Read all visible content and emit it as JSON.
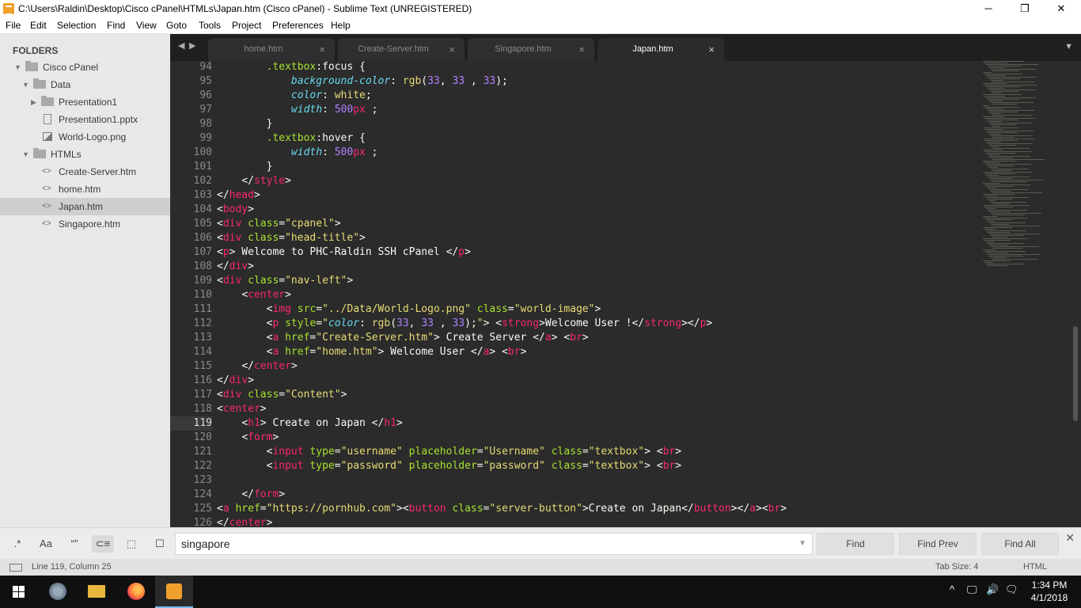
{
  "window": {
    "title": "C:\\Users\\Raldin\\Desktop\\Cisco cPanel\\HTMLs\\Japan.htm (Cisco cPanel) - Sublime Text (UNREGISTERED)",
    "minimize": "─",
    "maximize": "❐",
    "close": "✕"
  },
  "menu": [
    "File",
    "Edit",
    "Selection",
    "Find",
    "View",
    "Goto",
    "Tools",
    "Project",
    "Preferences",
    "Help"
  ],
  "sidebar": {
    "header": "FOLDERS",
    "items": [
      {
        "label": "Cisco cPanel",
        "kind": "folder-open"
      },
      {
        "label": "Data",
        "kind": "folder-open"
      },
      {
        "label": "Presentation1",
        "kind": "folder-closed"
      },
      {
        "label": "Presentation1.pptx",
        "kind": "file"
      },
      {
        "label": "World-Logo.png",
        "kind": "image"
      },
      {
        "label": "HTMLs",
        "kind": "folder-open"
      },
      {
        "label": "Create-Server.htm",
        "kind": "code"
      },
      {
        "label": "home.htm",
        "kind": "code"
      },
      {
        "label": "Japan.htm",
        "kind": "code",
        "selected": true
      },
      {
        "label": "Singapore.htm",
        "kind": "code"
      }
    ]
  },
  "tabs": [
    {
      "label": "home.htm",
      "active": false
    },
    {
      "label": "Create-Server.htm",
      "active": false
    },
    {
      "label": "Singapore.htm",
      "active": false
    },
    {
      "label": "Japan.htm",
      "active": true
    }
  ],
  "tab_controls": {
    "prev": "◀",
    "next": "▶",
    "overflow": "▼",
    "close": "×"
  },
  "editor": {
    "line_numbers": [
      "94",
      "95",
      "96",
      "97",
      "98",
      "99",
      "100",
      "101",
      "102",
      "103",
      "104",
      "105",
      "106",
      "107",
      "108",
      "109",
      "110",
      "111",
      "112",
      "113",
      "114",
      "115",
      "116",
      "117",
      "118",
      "119",
      "120",
      "121",
      "122",
      "123",
      "124",
      "125",
      "126"
    ],
    "current_line": "119",
    "lines": [
      [
        [
          "",
          "        "
        ],
        [
          "a",
          ".textbox"
        ],
        [
          "w",
          ":focus {"
        ]
      ],
      [
        [
          "",
          "            "
        ],
        [
          "p",
          "background-color"
        ],
        [
          "w",
          ": "
        ],
        [
          "v",
          "rgb"
        ],
        [
          "w",
          "("
        ],
        [
          "n",
          "33"
        ],
        [
          "w",
          ", "
        ],
        [
          "n",
          "33"
        ],
        [
          "w",
          " , "
        ],
        [
          "n",
          "33"
        ],
        [
          "w",
          ");"
        ]
      ],
      [
        [
          "",
          "            "
        ],
        [
          "p",
          "color"
        ],
        [
          "w",
          ": "
        ],
        [
          "v",
          "white"
        ],
        [
          "w",
          ";"
        ]
      ],
      [
        [
          "",
          "            "
        ],
        [
          "p",
          "width"
        ],
        [
          "w",
          ": "
        ],
        [
          "n",
          "500"
        ],
        [
          "t",
          "px"
        ],
        [
          "w",
          " ;"
        ]
      ],
      [
        [
          "",
          "        "
        ],
        [
          "w",
          "}"
        ]
      ],
      [
        [
          "",
          "        "
        ],
        [
          "a",
          ".textbox"
        ],
        [
          "w",
          ":hover {"
        ]
      ],
      [
        [
          "",
          "            "
        ],
        [
          "p",
          "width"
        ],
        [
          "w",
          ": "
        ],
        [
          "n",
          "500"
        ],
        [
          "t",
          "px"
        ],
        [
          "w",
          " ;"
        ]
      ],
      [
        [
          "",
          "        "
        ],
        [
          "w",
          "}"
        ]
      ],
      [
        [
          "",
          "    "
        ],
        [
          "w",
          "</"
        ],
        [
          "t",
          "style"
        ],
        [
          "w",
          ">"
        ]
      ],
      [
        [
          "w",
          "</"
        ],
        [
          "t",
          "head"
        ],
        [
          "w",
          ">"
        ]
      ],
      [
        [
          "w",
          "<"
        ],
        [
          "t",
          "body"
        ],
        [
          "w",
          ">"
        ]
      ],
      [
        [
          "w",
          "<"
        ],
        [
          "t",
          "div"
        ],
        [
          "w",
          " "
        ],
        [
          "a",
          "class"
        ],
        [
          "w",
          "="
        ],
        [
          "s",
          "\"cpanel\""
        ],
        [
          "w",
          ">"
        ]
      ],
      [
        [
          "w",
          "<"
        ],
        [
          "t",
          "div"
        ],
        [
          "w",
          " "
        ],
        [
          "a",
          "class"
        ],
        [
          "w",
          "="
        ],
        [
          "s",
          "\"head-title\""
        ],
        [
          "w",
          ">"
        ]
      ],
      [
        [
          "w",
          "<"
        ],
        [
          "t",
          "p"
        ],
        [
          "w",
          "> Welcome to PHC-Raldin SSH cPanel </"
        ],
        [
          "t",
          "p"
        ],
        [
          "w",
          ">"
        ]
      ],
      [
        [
          "w",
          "</"
        ],
        [
          "t",
          "div"
        ],
        [
          "w",
          ">"
        ]
      ],
      [
        [
          "w",
          "<"
        ],
        [
          "t",
          "div"
        ],
        [
          "w",
          " "
        ],
        [
          "a",
          "class"
        ],
        [
          "w",
          "="
        ],
        [
          "s",
          "\"nav-left\""
        ],
        [
          "w",
          ">"
        ]
      ],
      [
        [
          "",
          "    "
        ],
        [
          "w",
          "<"
        ],
        [
          "t",
          "center"
        ],
        [
          "w",
          ">"
        ]
      ],
      [
        [
          "",
          "        "
        ],
        [
          "w",
          "<"
        ],
        [
          "t",
          "img"
        ],
        [
          "w",
          " "
        ],
        [
          "a",
          "src"
        ],
        [
          "w",
          "="
        ],
        [
          "s",
          "\"../Data/World-Logo.png\""
        ],
        [
          "w",
          " "
        ],
        [
          "a",
          "class"
        ],
        [
          "w",
          "="
        ],
        [
          "s",
          "\"world-image\""
        ],
        [
          "w",
          ">"
        ]
      ],
      [
        [
          "",
          "        "
        ],
        [
          "w",
          "<"
        ],
        [
          "t",
          "p"
        ],
        [
          "w",
          " "
        ],
        [
          "a",
          "style"
        ],
        [
          "w",
          "="
        ],
        [
          "s",
          "\""
        ],
        [
          "p",
          "color"
        ],
        [
          "w",
          ": "
        ],
        [
          "v",
          "rgb"
        ],
        [
          "w",
          "("
        ],
        [
          "n",
          "33"
        ],
        [
          "w",
          ", "
        ],
        [
          "n",
          "33"
        ],
        [
          "w",
          " , "
        ],
        [
          "n",
          "33"
        ],
        [
          "w",
          ");"
        ],
        [
          "s",
          "\""
        ],
        [
          "w",
          "> <"
        ],
        [
          "t",
          "strong"
        ],
        [
          "w",
          ">Welcome User !</"
        ],
        [
          "t",
          "strong"
        ],
        [
          "w",
          "></"
        ],
        [
          "t",
          "p"
        ],
        [
          "w",
          ">"
        ]
      ],
      [
        [
          "",
          "        "
        ],
        [
          "w",
          "<"
        ],
        [
          "t",
          "a"
        ],
        [
          "w",
          " "
        ],
        [
          "a",
          "href"
        ],
        [
          "w",
          "="
        ],
        [
          "s",
          "\"Create-Server.htm\""
        ],
        [
          "w",
          "> Create Server </"
        ],
        [
          "t",
          "a"
        ],
        [
          "w",
          "> <"
        ],
        [
          "t",
          "br"
        ],
        [
          "w",
          ">"
        ]
      ],
      [
        [
          "",
          "        "
        ],
        [
          "w",
          "<"
        ],
        [
          "t",
          "a"
        ],
        [
          "w",
          " "
        ],
        [
          "a",
          "href"
        ],
        [
          "w",
          "="
        ],
        [
          "s",
          "\"home.htm\""
        ],
        [
          "w",
          "> Welcome User </"
        ],
        [
          "t",
          "a"
        ],
        [
          "w",
          "> <"
        ],
        [
          "t",
          "br"
        ],
        [
          "w",
          ">"
        ]
      ],
      [
        [
          "",
          "    "
        ],
        [
          "w",
          "</"
        ],
        [
          "t",
          "center"
        ],
        [
          "w",
          ">"
        ]
      ],
      [
        [
          "w",
          "</"
        ],
        [
          "t",
          "div"
        ],
        [
          "w",
          ">"
        ]
      ],
      [
        [
          "w",
          "<"
        ],
        [
          "t",
          "div"
        ],
        [
          "w",
          " "
        ],
        [
          "a",
          "class"
        ],
        [
          "w",
          "="
        ],
        [
          "s",
          "\"Content\""
        ],
        [
          "w",
          ">"
        ]
      ],
      [
        [
          "w",
          "<"
        ],
        [
          "t",
          "center"
        ],
        [
          "w",
          ">"
        ]
      ],
      [
        [
          "",
          "    "
        ],
        [
          "w",
          "<"
        ],
        [
          "t",
          "h1"
        ],
        [
          "w",
          "> Create on Japan </"
        ],
        [
          "t",
          "h1"
        ],
        [
          "w",
          ">"
        ]
      ],
      [
        [
          "",
          "    "
        ],
        [
          "w",
          "<"
        ],
        [
          "t",
          "form"
        ],
        [
          "w",
          ">"
        ]
      ],
      [
        [
          "",
          "        "
        ],
        [
          "w",
          "<"
        ],
        [
          "t",
          "input"
        ],
        [
          "w",
          " "
        ],
        [
          "a",
          "type"
        ],
        [
          "w",
          "="
        ],
        [
          "s",
          "\"username\""
        ],
        [
          "w",
          " "
        ],
        [
          "a",
          "placeholder"
        ],
        [
          "w",
          "="
        ],
        [
          "s",
          "\"Username\""
        ],
        [
          "w",
          " "
        ],
        [
          "a",
          "class"
        ],
        [
          "w",
          "="
        ],
        [
          "s",
          "\"textbox\""
        ],
        [
          "w",
          "> <"
        ],
        [
          "t",
          "br"
        ],
        [
          "w",
          ">"
        ]
      ],
      [
        [
          "",
          "        "
        ],
        [
          "w",
          "<"
        ],
        [
          "t",
          "input"
        ],
        [
          "w",
          " "
        ],
        [
          "a",
          "type"
        ],
        [
          "w",
          "="
        ],
        [
          "s",
          "\"password\""
        ],
        [
          "w",
          " "
        ],
        [
          "a",
          "placeholder"
        ],
        [
          "w",
          "="
        ],
        [
          "s",
          "\"password\""
        ],
        [
          "w",
          " "
        ],
        [
          "a",
          "class"
        ],
        [
          "w",
          "="
        ],
        [
          "s",
          "\"textbox\""
        ],
        [
          "w",
          "> <"
        ],
        [
          "t",
          "br"
        ],
        [
          "w",
          ">"
        ]
      ],
      [
        [
          "",
          ""
        ]
      ],
      [
        [
          "",
          "    "
        ],
        [
          "w",
          "</"
        ],
        [
          "t",
          "form"
        ],
        [
          "w",
          ">"
        ]
      ],
      [
        [
          "w",
          "<"
        ],
        [
          "t",
          "a"
        ],
        [
          "w",
          " "
        ],
        [
          "a",
          "href"
        ],
        [
          "w",
          "="
        ],
        [
          "s",
          "\"https://pornhub.com\""
        ],
        [
          "w",
          "><"
        ],
        [
          "t",
          "button"
        ],
        [
          "w",
          " "
        ],
        [
          "a",
          "class"
        ],
        [
          "w",
          "="
        ],
        [
          "s",
          "\"server-button\""
        ],
        [
          "w",
          ">Create on Japan</"
        ],
        [
          "t",
          "button"
        ],
        [
          "w",
          "></"
        ],
        [
          "t",
          "a"
        ],
        [
          "w",
          "><"
        ],
        [
          "t",
          "br"
        ],
        [
          "w",
          ">"
        ]
      ],
      [
        [
          "w",
          "</"
        ],
        [
          "t",
          "center"
        ],
        [
          "w",
          ">"
        ]
      ]
    ]
  },
  "findbar": {
    "options": [
      {
        "label": ".*",
        "on": false
      },
      {
        "label": "Aa",
        "on": false
      },
      {
        "label": "“”",
        "on": false
      },
      {
        "label": "⊂≡",
        "on": true
      },
      {
        "label": "⬚",
        "on": false
      },
      {
        "label": "☐",
        "on": false
      }
    ],
    "query": "singapore",
    "dropdown": "▼",
    "find": "Find",
    "find_prev": "Find Prev",
    "find_all": "Find All",
    "close": "✕"
  },
  "status": {
    "position": "Line 119, Column 25",
    "tab_size": "Tab Size: 4",
    "syntax": "HTML"
  },
  "taskbar": {
    "time": "1:34 PM",
    "date": "4/1/2018",
    "tray": [
      "^",
      "🖵",
      "🔊",
      "🗨"
    ]
  },
  "colors": {
    "keyword": "#f92672",
    "string": "#e6db74",
    "attr": "#a6e22e",
    "property": "#66d9ef",
    "number": "#ae81ff",
    "editor_bg": "#2b2b2b",
    "sidebar_bg": "#e8e8e8"
  }
}
